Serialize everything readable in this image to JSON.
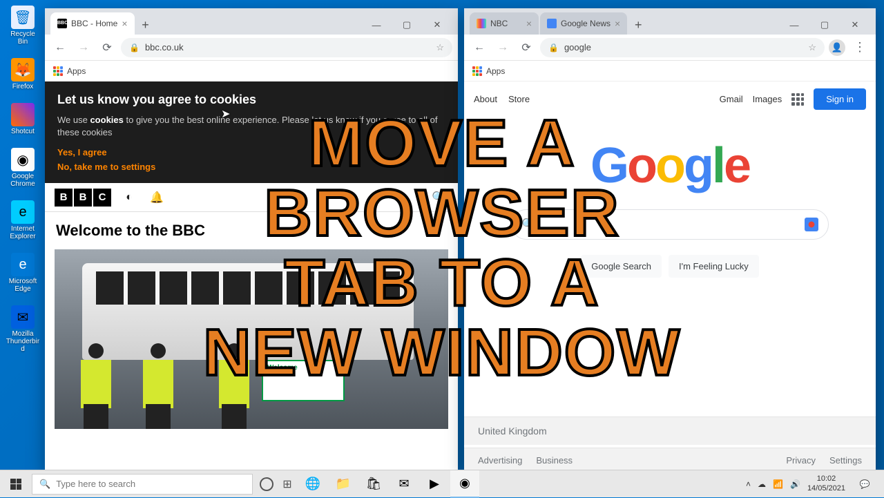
{
  "desktop_icons": [
    "Recycle Bin",
    "Firefox",
    "Shotcut",
    "Google Chrome",
    "Internet Explorer",
    "Microsoft Edge",
    "Mozilla Thunderbird"
  ],
  "win_left": {
    "tab_title": "BBC - Home",
    "url": "bbc.co.uk",
    "bookmarks_label": "Apps",
    "cookie": {
      "heading": "Let us know you agree to cookies",
      "body_pre": "We use ",
      "body_bold": "cookies",
      "body_post": " to give you the best online experience. Please let us know if you agree to all of these cookies",
      "yes": "Yes, I agree",
      "no": "No, take me to settings"
    },
    "page_heading": "Welcome to the BBC"
  },
  "win_right": {
    "tabs": [
      "NBC",
      "Google News"
    ],
    "url": "google",
    "bookmarks_label": "Apps",
    "header_links_left": [
      "About",
      "Store"
    ],
    "header_links_right": [
      "Gmail",
      "Images"
    ],
    "signin": "Sign in",
    "search_btn": "Google Search",
    "lucky_btn": "I'm Feeling Lucky",
    "country": "United Kingdom",
    "footer_left": [
      "Advertising",
      "Business"
    ],
    "footer_right": [
      "Privacy",
      "Settings"
    ]
  },
  "overlay": [
    "MOVE A",
    "BROWSER",
    "TAB TO A",
    "NEW WINDOW"
  ],
  "taskbar": {
    "search_placeholder": "Type here to search",
    "time": "10:02",
    "date": "14/05/2021"
  }
}
